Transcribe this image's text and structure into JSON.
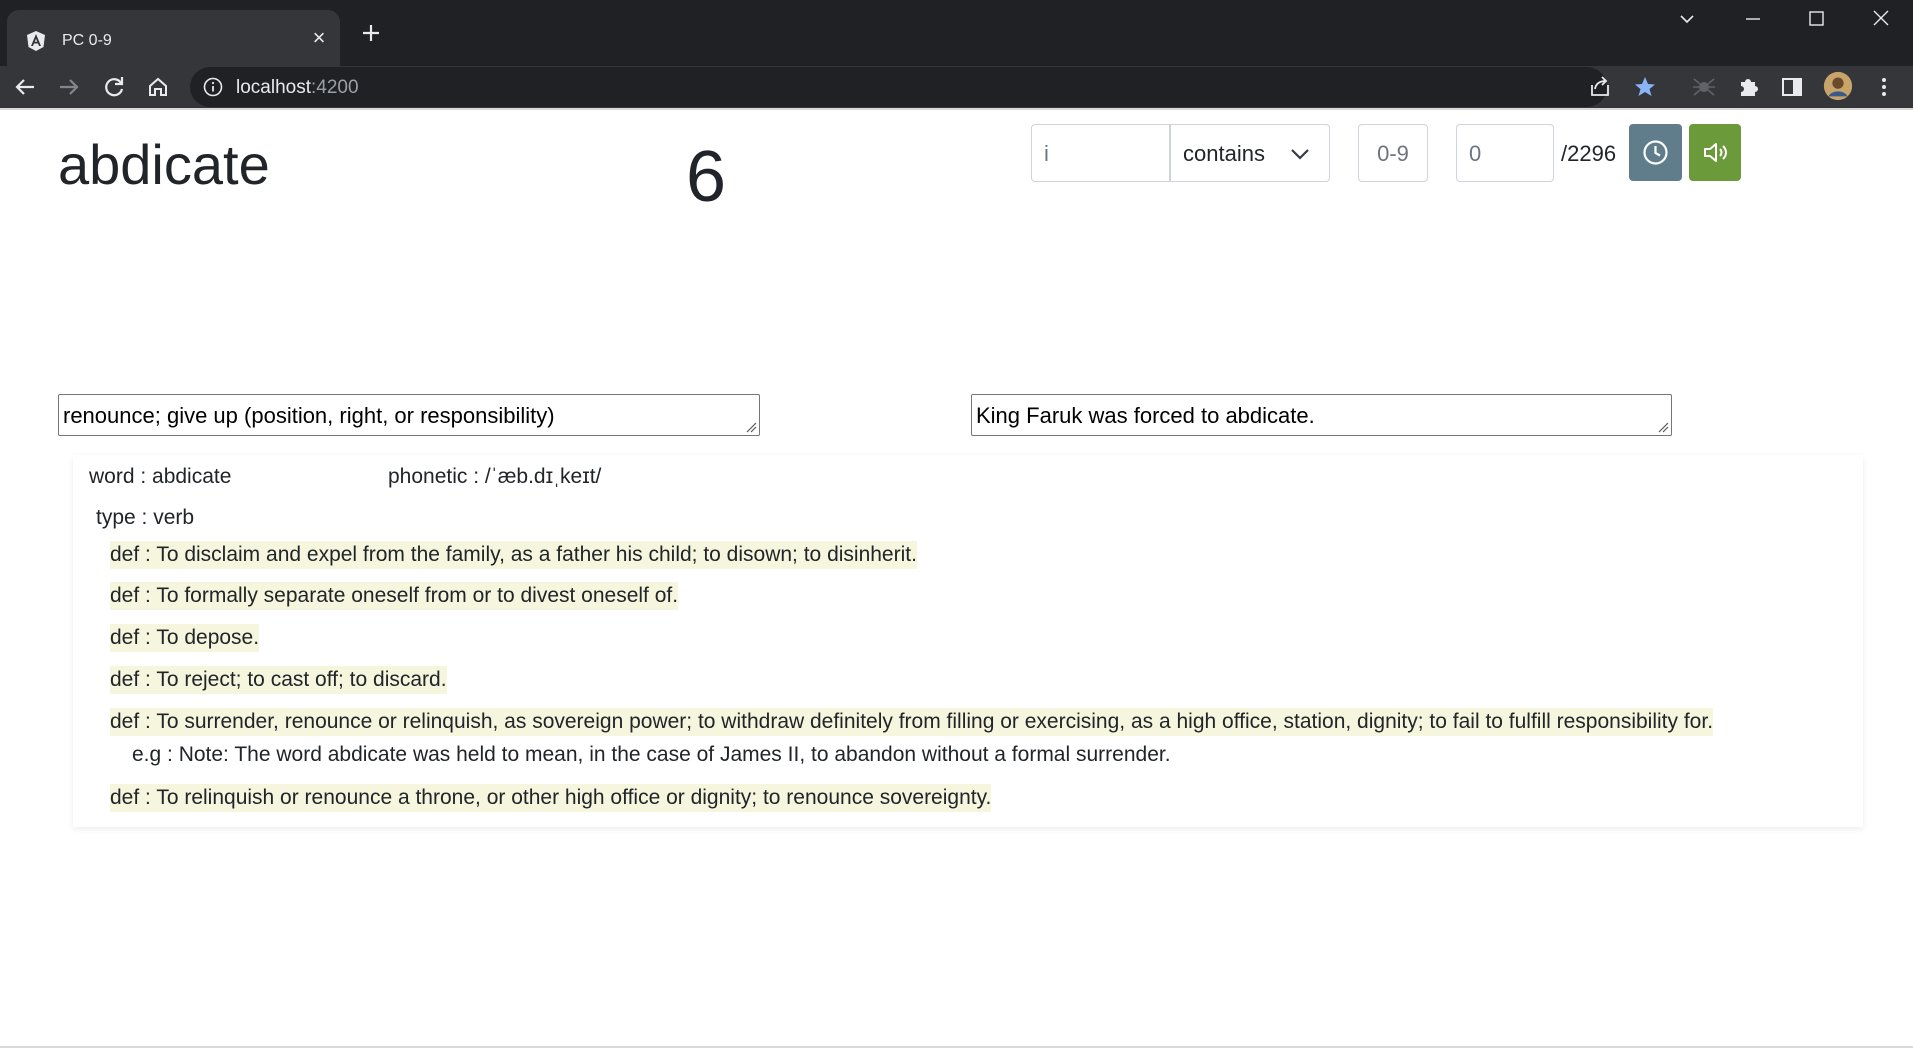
{
  "browser": {
    "tab_title": "PC 0-9",
    "url_host": "localhost",
    "url_port": ":4200"
  },
  "header": {
    "word": "abdicate",
    "count": "6"
  },
  "controls": {
    "search_value": "i",
    "mode_selected": "contains",
    "range_value": "0-9",
    "index_value": "0",
    "total": "/2296"
  },
  "fields": {
    "meaning": "renounce; give up (position, right, or responsibility)",
    "example": "King Faruk was forced to abdicate."
  },
  "entry": {
    "word_line": "word : abdicate",
    "phonetic_line": "phonetic : /ˈæb.dɪˌkeɪt/",
    "type_line": "type : verb",
    "defs": [
      "def : To disclaim and expel from the family, as a father his child; to disown; to disinherit.",
      "def : To formally separate oneself from or to divest oneself of.",
      "def : To depose.",
      "def : To reject; to cast off; to discard.",
      "def : To surrender, renounce or relinquish, as sovereign power; to withdraw definitely from filling or exercising, as a high office, station, dignity; to fail to fulfill responsibility for.",
      "def : To relinquish or renounce a throne, or other high office or dignity; to renounce sovereignty."
    ],
    "example_line": "e.g : Note: The word abdicate was held to mean, in the case of James II, to abandon without a formal surrender."
  },
  "colors": {
    "timer_button": "#5f7d8a",
    "sound_button": "#6a9a3a",
    "def_highlight": "#f6f6de"
  }
}
